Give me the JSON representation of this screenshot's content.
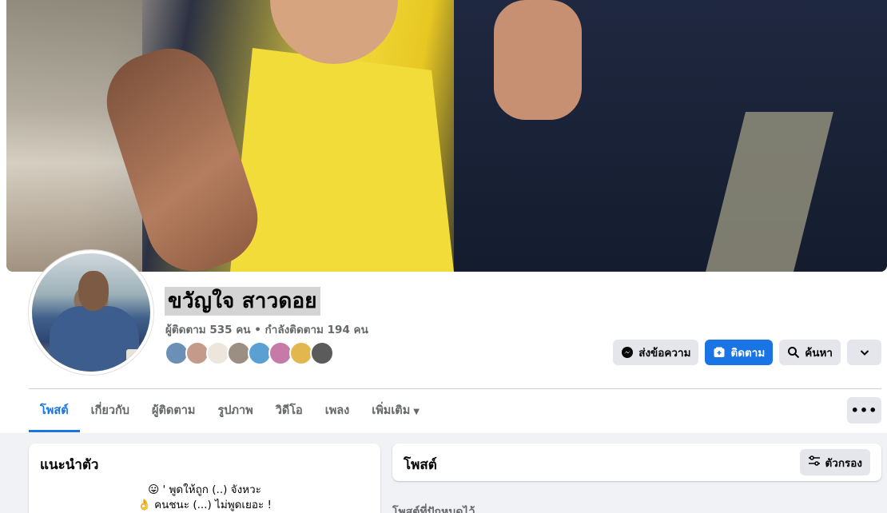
{
  "profile": {
    "name": "ขวัญใจ สาวดอย",
    "followers": "ผู้ติดตาม 535 คน • กำลังติดตาม 194 คน"
  },
  "friend_colors": [
    "#6b8fb5",
    "#c49a8a",
    "#ede6dc",
    "#9b8f83",
    "#5aa0d2",
    "#c67aa8",
    "#e2b74e",
    "#5b5b5b"
  ],
  "actions": {
    "message_label": "ส่งข้อความ",
    "follow_label": "ติดตาม",
    "search_label": "ค้นหา"
  },
  "tabs": [
    {
      "label": "โพสต์"
    },
    {
      "label": "เกี่ยวกับ"
    },
    {
      "label": "ผู้ติดตาม"
    },
    {
      "label": "รูปภาพ"
    },
    {
      "label": "วิดีโอ"
    },
    {
      "label": "เพลง"
    },
    {
      "label": "เพิ่มเติม"
    }
  ],
  "intro": {
    "title": "แนะนำตัว",
    "line1": "😛 ' พูดให้ถูก (..) จังหวะ",
    "line2": "👌 คนชนะ (...) ไม่พูดเยอะ !"
  },
  "posts": {
    "title": "โพสต์",
    "filter_label": "ตัวกรอง",
    "pinned_label": "โพสต์ที่ปักหมุดไว้"
  },
  "colors": {
    "accent": "#1b74e4",
    "secondary_button": "#e4e6eb",
    "muted_text": "#65676b",
    "feed_background": "#f0f2f5"
  }
}
